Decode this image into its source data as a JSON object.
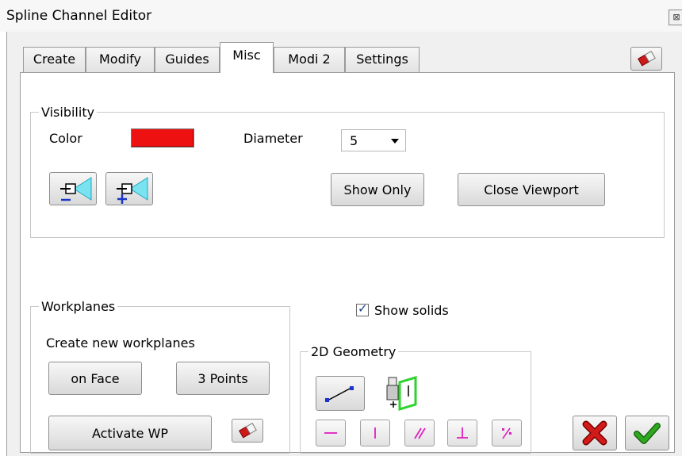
{
  "window": {
    "title": "Spline Channel Editor",
    "close_glyph": "⊠"
  },
  "tabs": [
    {
      "label": "Create",
      "active": false
    },
    {
      "label": "Modify",
      "active": false
    },
    {
      "label": "Guides",
      "active": false
    },
    {
      "label": "Misc",
      "active": true
    },
    {
      "label": "Modi 2",
      "active": false
    },
    {
      "label": "Settings",
      "active": false
    }
  ],
  "visibility": {
    "legend": "Visibility",
    "color_label": "Color",
    "color_value": "#ee1111",
    "diameter_label": "Diameter",
    "diameter_value": "5",
    "show_only_label": "Show Only",
    "close_viewport_label": "Close Viewport"
  },
  "show_solids": {
    "label": "Show solids",
    "checked": true
  },
  "workplanes": {
    "legend": "Workplanes",
    "caption": "Create new workplanes",
    "on_face_label": "on Face",
    "three_points_label": "3 Points",
    "activate_label": "Activate WP"
  },
  "geometry": {
    "legend": "2D Geometry",
    "tools": [
      "line-tool-icon",
      "workplane-tool-icon",
      "horizontal-constraint-icon",
      "vertical-constraint-icon",
      "parallel-constraint-icon",
      "perpendicular-constraint-icon",
      "midpoint-constraint-icon"
    ]
  },
  "dialog": {
    "cancel_icon": "red-x-icon",
    "ok_icon": "green-check-icon"
  },
  "colors": {
    "accent_red": "#ee1111",
    "constraint_magenta": "#e020c0",
    "ok_green": "#2fa81f",
    "cancel_red": "#d11a1a"
  }
}
